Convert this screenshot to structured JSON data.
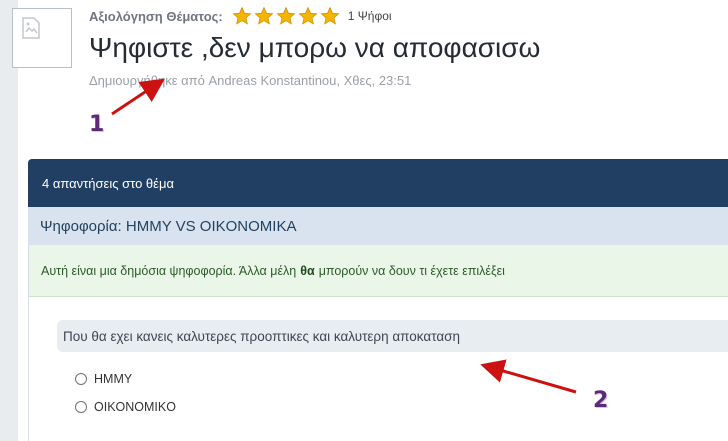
{
  "topic": {
    "rating_label": "Αξιολόγηση Θέματος:",
    "star_count": 5,
    "star_color": "#f4b400",
    "votes_text": "1 Ψήφοι",
    "title": "Ψηφιστε ,δεν μπορω να αποφασισω",
    "byline_prefix": "Δημιουργήθηκε από",
    "author": "Andreas Konstantinou",
    "timestamp": ", Χθες, 23:51",
    "avatar_icon": "broken-image-icon"
  },
  "annotations": {
    "arrow_color": "#cc1111",
    "badge_1": "1",
    "badge_2": "2"
  },
  "replies": {
    "count_text": "4 απαντήσεις στο θέμα"
  },
  "poll": {
    "title": "Ψηφοφορία: HMMY VS OIKONOMIKA",
    "notice_before": "Αυτή είναι μια δημόσια ψηφοφορία. Άλλα μέλη",
    "notice_bold": "θα",
    "notice_after": "μπορούν να δουν τι έχετε επιλέξει",
    "question": "Που θα εχει κανεις καλυτερες προοπτικες και καλυτερη αποκαταση",
    "options": [
      {
        "label": "HMMY"
      },
      {
        "label": "OIKONOMIKO"
      }
    ]
  }
}
